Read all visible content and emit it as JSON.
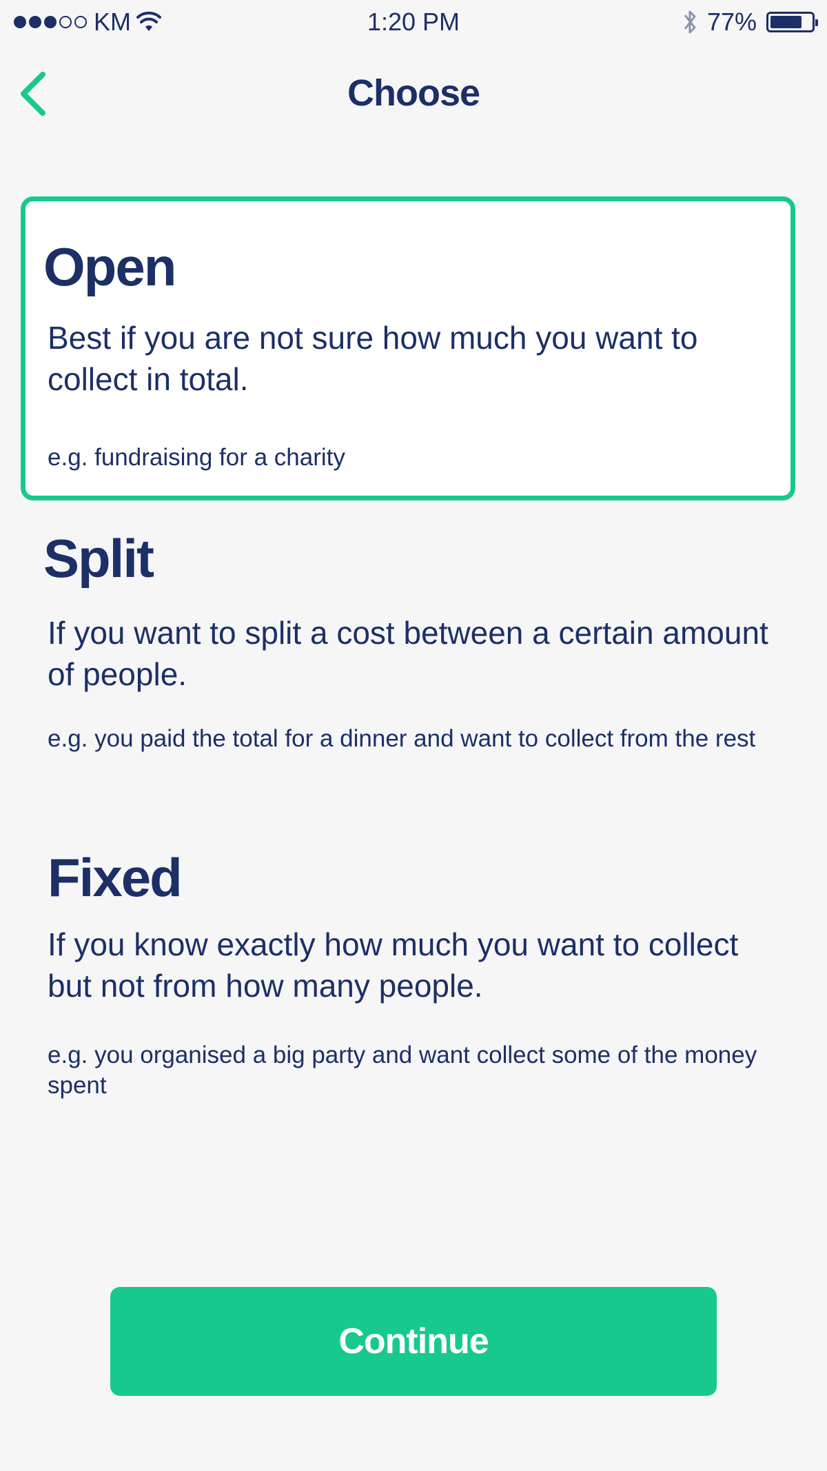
{
  "status_bar": {
    "carrier": "KM",
    "time": "1:20 PM",
    "battery_percent": "77%",
    "battery_level": 0.77,
    "signal_bars_filled": 3,
    "signal_bars_total": 5
  },
  "nav": {
    "title": "Choose",
    "back_icon": "chevron-left-icon"
  },
  "options": [
    {
      "title": "Open",
      "description": "Best if you are not sure how much you want to collect in total.",
      "example": "e.g. fundraising for a charity",
      "selected": true
    },
    {
      "title": "Split",
      "description": "If you want to split a cost between a certain amount of people.",
      "example": "e.g. you paid the total for a dinner and want to collect from the rest",
      "selected": false
    },
    {
      "title": "Fixed",
      "description": "If you know exactly how much you want to collect but not from how many people.",
      "example": "e.g. you organised a big party and want collect some of the money spent",
      "selected": false
    }
  ],
  "continue_label": "Continue",
  "colors": {
    "accent": "#17c98e",
    "text": "#1c2f66",
    "background": "#f6f6f7"
  }
}
